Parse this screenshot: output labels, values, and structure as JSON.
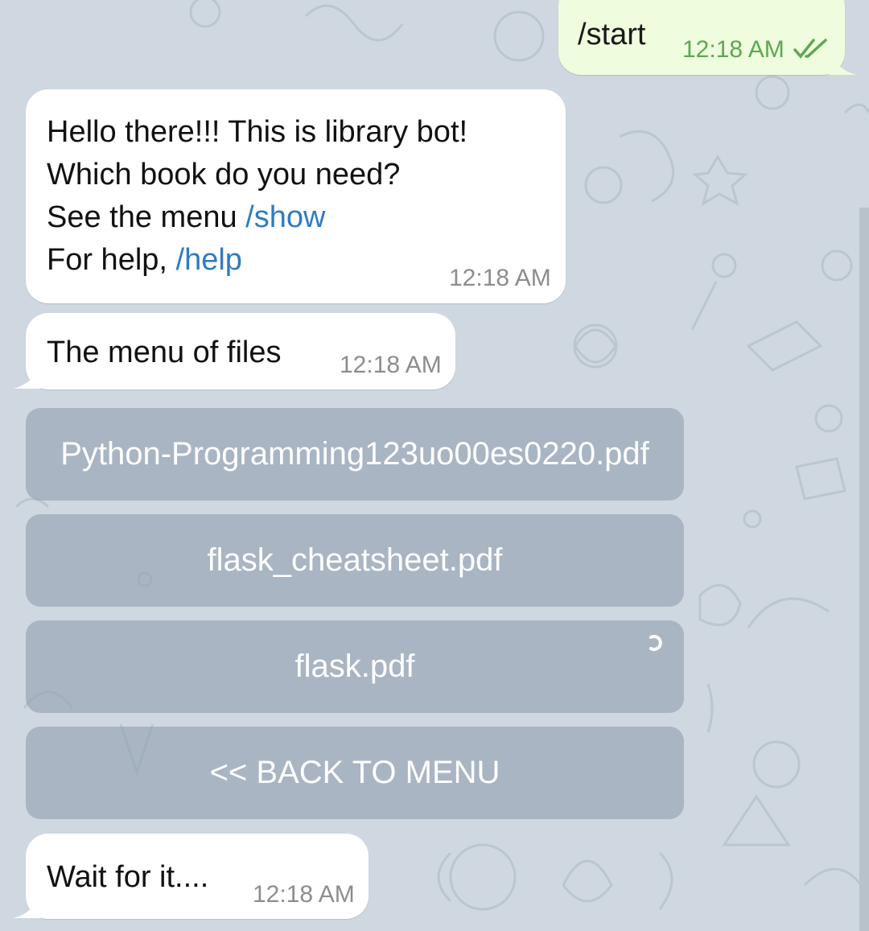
{
  "messages": {
    "start": {
      "text": "/start",
      "time": "12:18 AM"
    },
    "welcome": {
      "line1": "Hello there!!! This is library bot!",
      "line2": "Which book do you need?",
      "line3_prefix": "See the menu ",
      "line3_link": "/show",
      "line4_prefix": "For help, ",
      "line4_link": "/help",
      "time": "12:18 AM"
    },
    "menu_files": {
      "text": "The menu of files",
      "time": "12:18 AM"
    },
    "wait": {
      "text": "Wait for it....",
      "time": "12:18 AM"
    }
  },
  "keyboard": {
    "buttons": [
      {
        "label": "Python-Programming123uo00es0220.pdf"
      },
      {
        "label": "flask_cheatsheet.pdf"
      },
      {
        "label": "flask.pdf"
      },
      {
        "label": "<< BACK TO MENU"
      }
    ]
  },
  "icons": {
    "read_receipt": "double-check-icon",
    "loading": "loading-spinner-icon"
  },
  "colors": {
    "background": "#cfd8e0",
    "incoming_bubble": "#ffffff",
    "outgoing_bubble": "#effdde",
    "link": "#2f7bc2",
    "check": "#5fa750",
    "keyboard_button": "#9aa6b3"
  }
}
